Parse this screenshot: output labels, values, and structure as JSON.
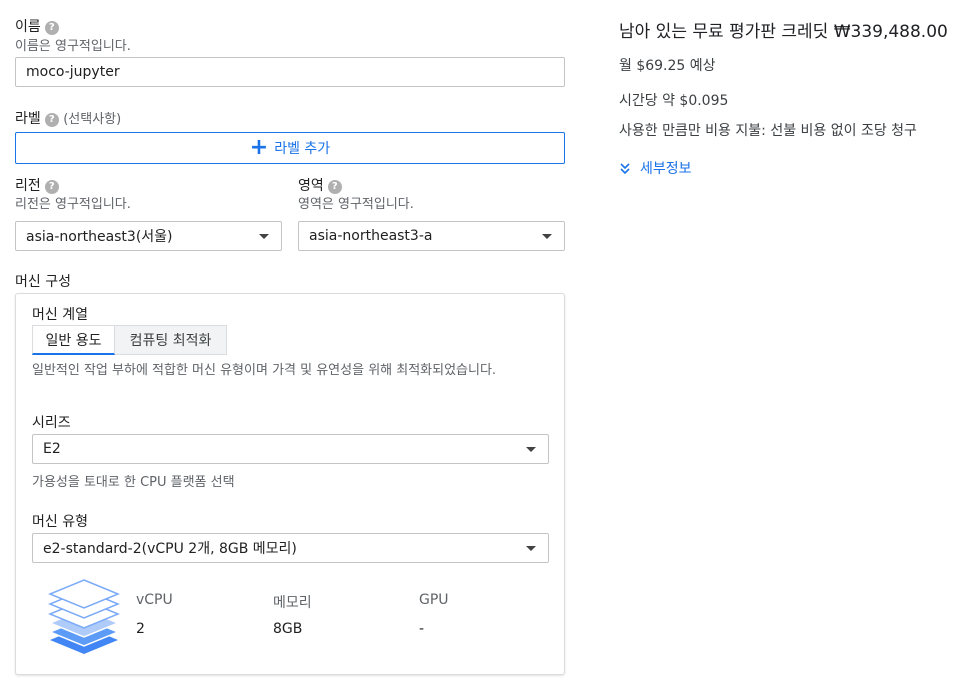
{
  "name": {
    "label": "이름",
    "help_icon": "help-icon",
    "hint": "이름은 영구적입니다.",
    "value": "moco-jupyter"
  },
  "label_section": {
    "label": "라벨",
    "optional": "(선택사항)",
    "add_button": "라벨 추가"
  },
  "region": {
    "label": "리전",
    "hint": "리전은 영구적입니다.",
    "value": "asia-northeast3(서울)"
  },
  "zone": {
    "label": "영역",
    "hint": "영역은 영구적입니다.",
    "value": "asia-northeast3-a"
  },
  "machine_config": {
    "title": "머신 구성",
    "family_label": "머신 계열",
    "tabs": [
      {
        "label": "일반 용도",
        "selected": true
      },
      {
        "label": "컴퓨팅 최적화",
        "selected": false
      }
    ],
    "family_description": "일반적인 작업 부하에 적합한 머신 유형이며 가격 및 유연성을 위해 최적화되었습니다.",
    "series_label": "시리즈",
    "series_value": "E2",
    "series_hint": "가용성을 토대로 한 CPU 플랫폼 선택",
    "machine_type_label": "머신 유형",
    "machine_type_value": "e2-standard-2(vCPU 2개, 8GB 메모리)",
    "specs": {
      "headers": [
        "vCPU",
        "메모리",
        "GPU"
      ],
      "values": [
        "2",
        "8GB",
        "-"
      ]
    }
  },
  "pricing": {
    "remaining_credit": "남아 있는 무료 평가판 크레딧 ₩339,488.00",
    "monthly": "월 $69.25 예상",
    "hourly": "시간당 약 $0.095",
    "note": "사용한 만큼만 비용 지불: 선불 비용 없이 조당 청구",
    "details_link": "세부정보"
  },
  "colors": {
    "accent": "#1a73e8",
    "stack_icon": "#4285f4"
  }
}
